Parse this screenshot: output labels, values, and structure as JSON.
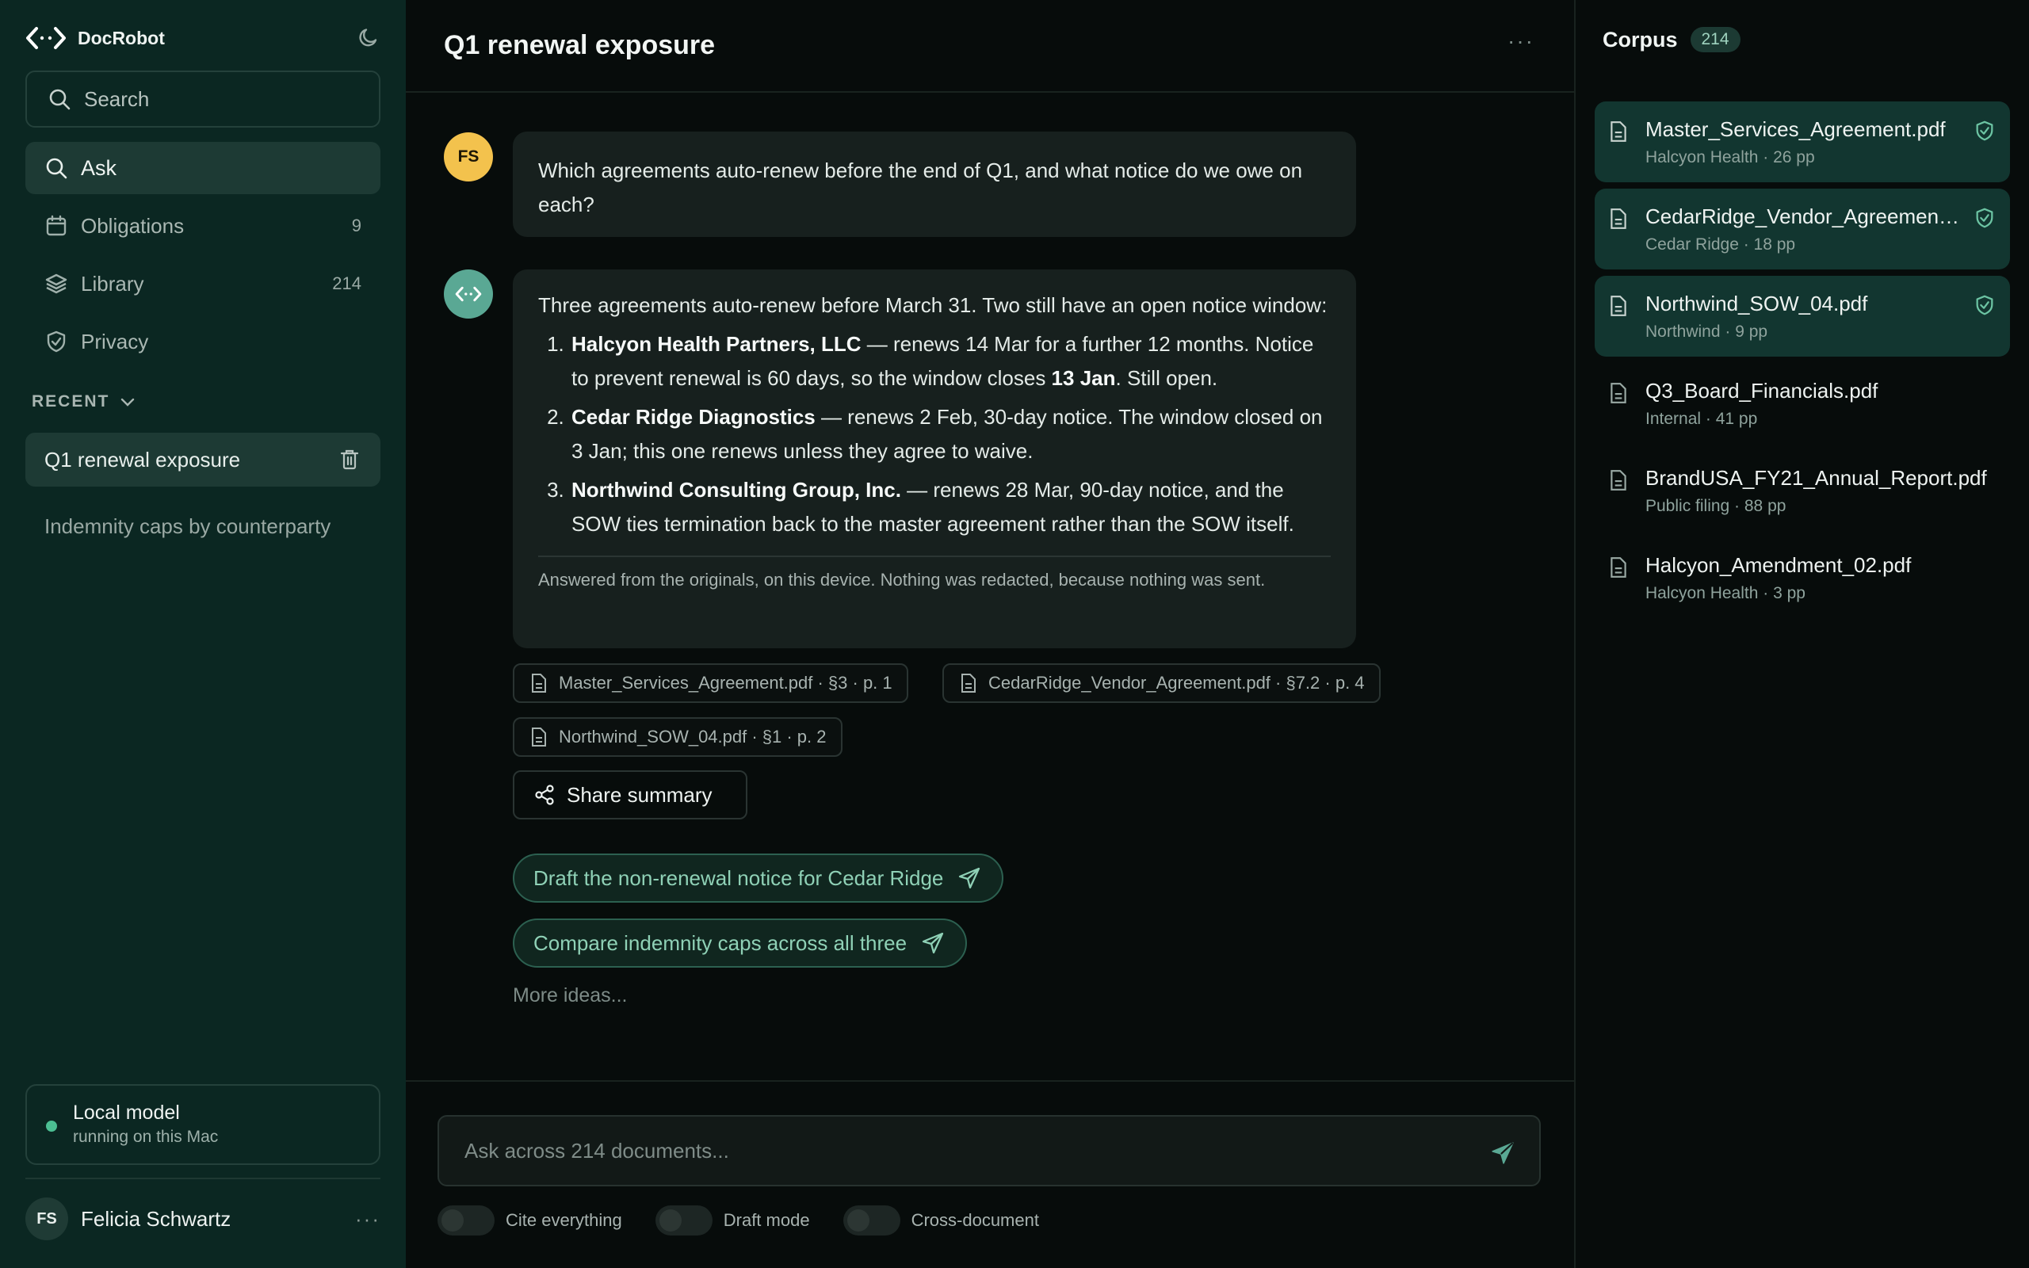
{
  "app": {
    "name": "DocRobot"
  },
  "sidebar": {
    "search_label": "Search",
    "nav": [
      {
        "label": "Ask",
        "count": ""
      },
      {
        "label": "Obligations",
        "count": "9"
      },
      {
        "label": "Library",
        "count": "214"
      },
      {
        "label": "Privacy",
        "count": ""
      }
    ],
    "recent_heading": "RECENT",
    "recent": [
      {
        "label": "Q1 renewal exposure"
      },
      {
        "label": "Indemnity caps by counterparty"
      }
    ],
    "model": {
      "title": "Local model",
      "subtitle": "running on this Mac",
      "status_color": "#4cbf93"
    },
    "user": {
      "initials": "FS",
      "name": "Felicia Schwartz",
      "more": "···"
    }
  },
  "conversation": {
    "title": "Q1 renewal exposure",
    "more": "···",
    "user_initials": "FS",
    "question": "Which agreements auto-renew before the end of Q1, and what notice do we owe on each?",
    "answer": {
      "intro": "Three agreements auto-renew before March 31. Two still have an open notice window:",
      "items": [
        {
          "name": "Halcyon Health Partners, LLC",
          "text_a": " — renews 14 Mar for a further 12 months. Notice to prevent renewal is 60 days, so the window closes ",
          "strong": "13 Jan",
          "text_b": ". Still open."
        },
        {
          "name": "Cedar Ridge Diagnostics",
          "text_a": " — renews 2 Feb, 30-day notice. The window closed on 3 Jan; this one renews unless they agree to waive.",
          "strong": "",
          "text_b": ""
        },
        {
          "name": "Northwind Consulting Group, Inc.",
          "text_a": " — renews 28 Mar, 90-day notice, and the SOW ties termination back to the master agreement rather than the SOW itself.",
          "strong": "",
          "text_b": ""
        }
      ],
      "footnote": "Answered from the originals, on this device. Nothing was redacted, because nothing was sent."
    },
    "citations": [
      "Master_Services_Agreement.pdf · §3 · p. 1",
      "CedarRidge_Vendor_Agreement.pdf · §7.2 · p. 4",
      "Northwind_SOW_04.pdf · §1 · p. 2"
    ],
    "share_label": "Share summary",
    "suggestions": [
      "Draft the non-renewal notice for Cedar Ridge",
      "Compare indemnity caps across all three"
    ],
    "more_ideas": "More ideas..."
  },
  "composer": {
    "placeholder": "Ask across 214 documents...",
    "toggles": [
      {
        "label": "Cite everything",
        "on": false
      },
      {
        "label": "Draft mode",
        "on": false
      },
      {
        "label": "Cross-document",
        "on": false
      }
    ]
  },
  "corpus": {
    "title": "Corpus",
    "count": "214",
    "documents": [
      {
        "name": "Master_Services_Agreement.pdf",
        "meta": "Halcyon Health · 26 pp",
        "in_context": true
      },
      {
        "name": "CedarRidge_Vendor_Agreement.pdf",
        "meta": "Cedar Ridge · 18 pp",
        "in_context": true
      },
      {
        "name": "Northwind_SOW_04.pdf",
        "meta": "Northwind · 9 pp",
        "in_context": true
      },
      {
        "name": "Q3_Board_Financials.pdf",
        "meta": "Internal · 41 pp",
        "in_context": false
      },
      {
        "name": "BrandUSA_FY21_Annual_Report.pdf",
        "meta": "Public filing · 88 pp",
        "in_context": false
      },
      {
        "name": "Halcyon_Amendment_02.pdf",
        "meta": "Halcyon Health · 3 pp",
        "in_context": false
      }
    ]
  },
  "colors": {
    "accent": "#5aa894",
    "sidebar_bg": "#0b2722",
    "avatar_user": "#f3c24d"
  }
}
